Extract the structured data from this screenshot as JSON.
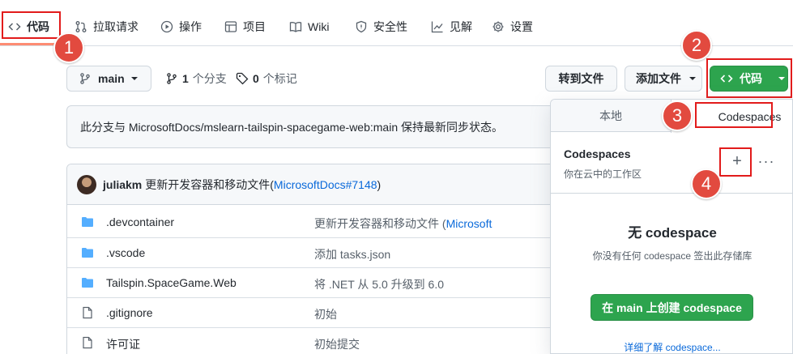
{
  "nav": {
    "items": [
      {
        "label": "代码",
        "icon": "code-icon"
      },
      {
        "label": "拉取请求",
        "icon": "pull-request-icon"
      },
      {
        "label": "操作",
        "icon": "play-icon"
      },
      {
        "label": "项目",
        "icon": "table-icon"
      },
      {
        "label": "Wiki",
        "icon": "book-icon"
      },
      {
        "label": "安全性",
        "icon": "shield-icon"
      },
      {
        "label": "见解",
        "icon": "graph-icon"
      },
      {
        "label": "设置",
        "icon": "gear-icon"
      }
    ]
  },
  "toolbar": {
    "branch": "main",
    "branch_count": "1",
    "branch_label": "个分支",
    "tag_count": "0",
    "tag_label": "个标记",
    "goto_file": "转到文件",
    "add_file": "添加文件",
    "code_button": "代码"
  },
  "sync_notice": "此分支与 MicrosoftDocs/mslearn-tailspin-spacegame-web:main 保持最新同步状态。",
  "commit": {
    "author": "juliakm",
    "message": "更新开发容器和移动文件(",
    "link": "MicrosoftDocs#7148",
    "close": ")"
  },
  "files": [
    {
      "name": ".devcontainer",
      "type": "folder",
      "message": "更新开发容器和移动文件 (",
      "message_link": "Microsoft"
    },
    {
      "name": ".vscode",
      "type": "folder",
      "message": "添加 tasks.json",
      "message_link": ""
    },
    {
      "name": "Tailspin.SpaceGame.Web",
      "type": "folder",
      "message": "将 .NET 从 5.0 升级到 6.0",
      "message_link": ""
    },
    {
      "name": ".gitignore",
      "type": "file",
      "message": "初始",
      "message_link": ""
    },
    {
      "name": "许可证",
      "type": "file",
      "message": "初始提交",
      "message_link": ""
    }
  ],
  "panel": {
    "tab_local": "本地",
    "tab_codespaces": "Codespaces",
    "heading": "Codespaces",
    "subheading": "你在云中的工作区",
    "plus": "+",
    "more": "···",
    "empty_title": "无 codespace",
    "empty_desc": "你没有任何 codespace 签出此存储库",
    "create_button": "在 main 上创建 codespace",
    "learn_more": "详细了解 codespace..."
  },
  "callouts": [
    "1",
    "2",
    "3",
    "4"
  ],
  "colors": {
    "accent_green": "#2da44e",
    "callout_red": "#e24a3f",
    "link_blue": "#0969da",
    "folder_blue": "#54aeff",
    "tab_underline": "#fd8c73"
  }
}
